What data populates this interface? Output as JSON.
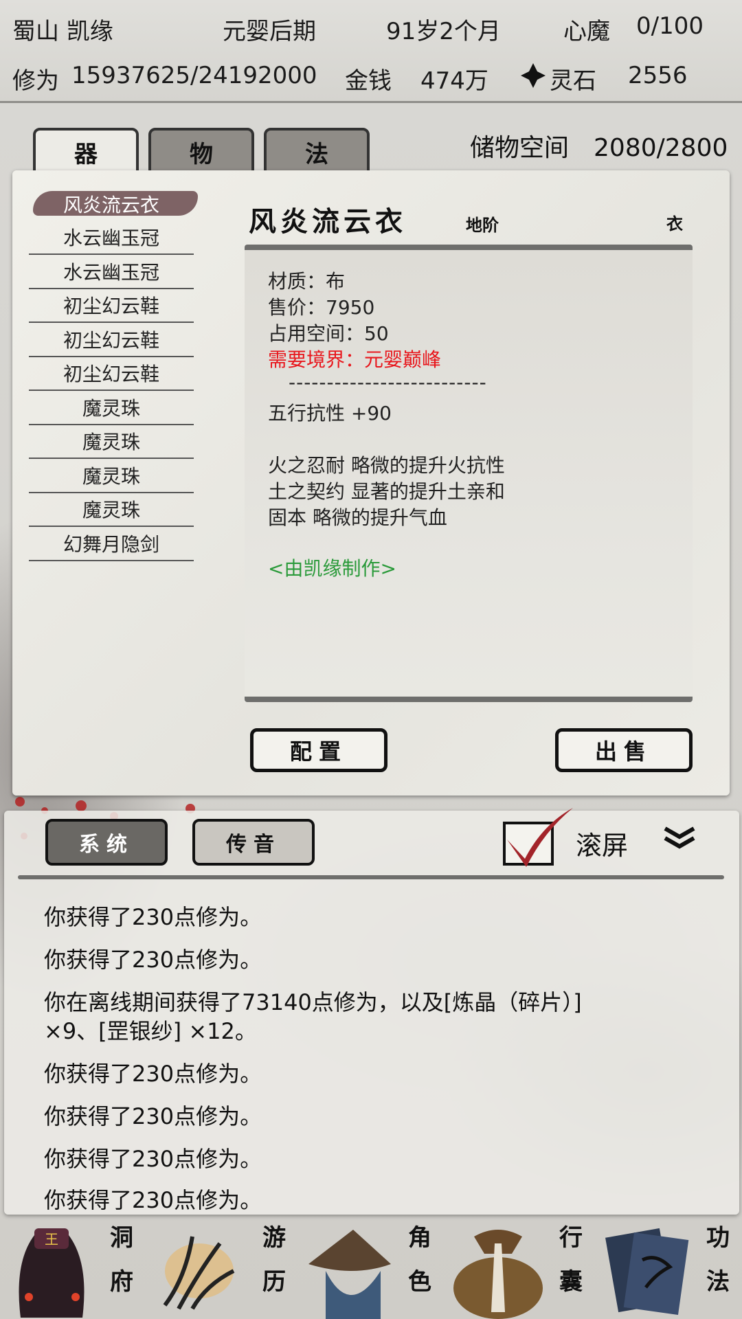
{
  "header": {
    "name": "蜀山 凯缘",
    "realm": "元婴后期",
    "age": "91岁2个月",
    "heart_demon_label": "心魔",
    "heart_demon_value": "0/100",
    "cultivation_label": "修为",
    "cultivation_value": "15937625/24192000",
    "money_label": "金钱",
    "money_value": "474万",
    "spirit_stone_label": "灵石",
    "spirit_stone_value": "2556"
  },
  "tabs": [
    {
      "label": "器",
      "active": true
    },
    {
      "label": "物",
      "active": false
    },
    {
      "label": "法",
      "active": false
    }
  ],
  "storage": {
    "label": "储物空间",
    "value": "2080/2800"
  },
  "items": [
    "风炎流云衣",
    "水云幽玉冠",
    "水云幽玉冠",
    "初尘幻云鞋",
    "初尘幻云鞋",
    "初尘幻云鞋",
    "魔灵珠",
    "魔灵珠",
    "魔灵珠",
    "魔灵珠",
    "幻舞月隐剑"
  ],
  "detail": {
    "title": "风炎流云衣",
    "grade": "地阶",
    "type": "衣",
    "material": "材质：布",
    "price": "售价：7950",
    "space": "占用空间：50",
    "requirement": "需要境界：元婴巅峰",
    "dashes": "--------------------------",
    "stat": "五行抗性 +90",
    "traits": [
      "火之忍耐 略微的提升火抗性",
      "土之契约 显著的提升土亲和",
      "固本 略微的提升气血"
    ],
    "maker": "<由凯缘制作>"
  },
  "buttons": {
    "equip": "配置",
    "sell": "出售"
  },
  "chat": {
    "tabs": [
      {
        "label": "系统",
        "active": true
      },
      {
        "label": "传音",
        "active": false
      }
    ],
    "scroll_label": "滚屏",
    "scroll_checked": true,
    "messages": [
      "你获得了230点修为。",
      "你获得了230点修为。",
      "你在离线期间获得了73140点修为，以及[炼晶（碎片）]",
      "×9、[罡银纱] ×12。",
      "你获得了230点修为。",
      "你获得了230点修为。",
      "你获得了230点修为。",
      "你获得了230点修为。"
    ]
  },
  "nav": [
    {
      "label1": "洞",
      "label2": "府",
      "icon": "cave-icon"
    },
    {
      "label1": "游",
      "label2": "历",
      "icon": "travel-icon"
    },
    {
      "label1": "角",
      "label2": "色",
      "icon": "character-icon"
    },
    {
      "label1": "行",
      "label2": "囊",
      "icon": "bag-icon"
    },
    {
      "label1": "功",
      "label2": "法",
      "icon": "book-icon"
    }
  ],
  "colors": {
    "requirement": "#e8161c",
    "maker": "#2a9a3a",
    "selected_item": "#6a4a4e"
  }
}
